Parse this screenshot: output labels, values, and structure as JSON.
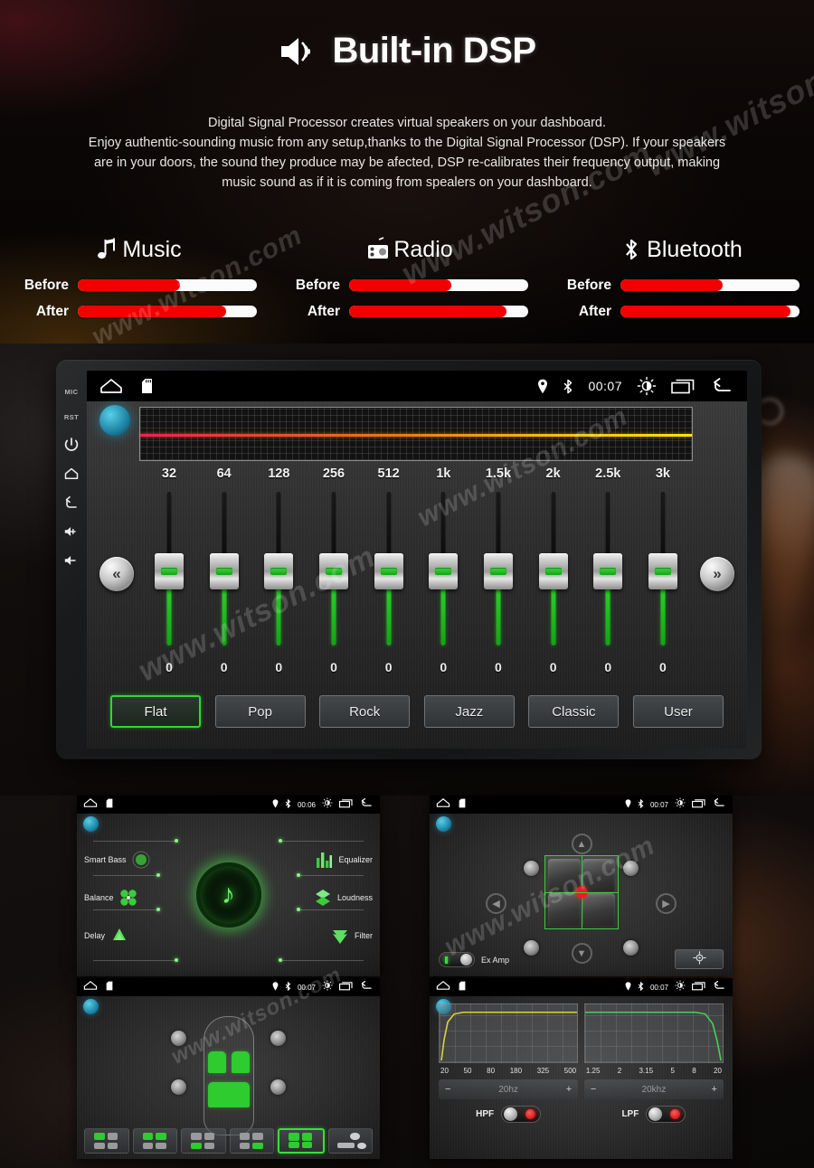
{
  "hero": {
    "icon": "speaker-wave-icon",
    "title": "Built-in DSP",
    "paragraph_lines": [
      "Digital Signal Processor creates virtual speakers on your dashboard.",
      "Enjoy authentic-sounding music from any setup,thanks to the Digital Signal Processor (DSP). If your speakers",
      "are in your doors, the sound they produce may be afected, DSP re-calibrates their frequency output, making",
      "music sound as if it is coming from spealers on your dashboard."
    ]
  },
  "comparison": {
    "before_label": "Before",
    "after_label": "After",
    "bar_empty_color": "#fbfbfb",
    "bar_fill_color": "#f20000",
    "columns": [
      {
        "icon": "music-note-icon",
        "label": "Music",
        "before_pct": 57,
        "after_pct": 83
      },
      {
        "icon": "radio-icon",
        "label": "Radio",
        "before_pct": 57,
        "after_pct": 88
      },
      {
        "icon": "bluetooth-icon",
        "label": "Bluetooth",
        "before_pct": 57,
        "after_pct": 95
      }
    ]
  },
  "device": {
    "side_buttons": [
      {
        "name": "mic-label",
        "label": "MIC",
        "type": "text"
      },
      {
        "name": "reset-label",
        "label": "RST",
        "type": "text"
      },
      {
        "name": "power-icon",
        "label": "",
        "type": "icon"
      },
      {
        "name": "home-icon",
        "label": "",
        "type": "icon"
      },
      {
        "name": "back-icon",
        "label": "",
        "type": "icon"
      },
      {
        "name": "volume-up-icon",
        "label": "",
        "type": "icon"
      },
      {
        "name": "volume-down-icon",
        "label": "",
        "type": "icon"
      }
    ],
    "statusbar": {
      "home_icon": "home-icon",
      "sdcard_icon": "sdcard-icon",
      "location_icon": "location-pin-icon",
      "bluetooth_icon": "bluetooth-icon",
      "clock": "00:07",
      "brightness_icon": "brightness-icon",
      "recents_icon": "recent-apps-icon",
      "back_icon": "back-arrow-icon"
    },
    "equalizer": {
      "prev_label": "«",
      "next_label": "»",
      "curve_gradient": [
        "#ff1569",
        "#f07a13",
        "#ffe400"
      ],
      "bands": [
        {
          "freq": "32",
          "value": "0"
        },
        {
          "freq": "64",
          "value": "0"
        },
        {
          "freq": "128",
          "value": "0"
        },
        {
          "freq": "256",
          "value": "0"
        },
        {
          "freq": "512",
          "value": "0"
        },
        {
          "freq": "1k",
          "value": "0"
        },
        {
          "freq": "1.5k",
          "value": "0"
        },
        {
          "freq": "2k",
          "value": "0"
        },
        {
          "freq": "2.5k",
          "value": "0"
        },
        {
          "freq": "3k",
          "value": "0"
        }
      ],
      "presets": [
        {
          "label": "Flat",
          "selected": true
        },
        {
          "label": "Pop",
          "selected": false
        },
        {
          "label": "Rock",
          "selected": false
        },
        {
          "label": "Jazz",
          "selected": false
        },
        {
          "label": "Classic",
          "selected": false
        },
        {
          "label": "User",
          "selected": false
        }
      ],
      "selected_preset": "Flat",
      "selected_color": "#2fd92f"
    }
  },
  "thumbnails": {
    "dsp_menu": {
      "clock": "00:06",
      "left_items": [
        {
          "label": "Smart Bass",
          "icon": "smart-bass-icon"
        },
        {
          "label": "Balance",
          "icon": "balance-icon"
        },
        {
          "label": "Delay",
          "icon": "delay-icon"
        }
      ],
      "right_items": [
        {
          "label": "Equalizer",
          "icon": "equalizer-icon"
        },
        {
          "label": "Loudness",
          "icon": "loudness-icon"
        },
        {
          "label": "Filter",
          "icon": "filter-icon"
        }
      ],
      "center_icon": "music-note-orb-icon"
    },
    "sound_field": {
      "clock": "00:07",
      "ex_amp_label": "Ex Amp",
      "ex_amp_on": true,
      "target_icon": "crosshair-icon",
      "up_icon": "chevron-up-icon",
      "down_icon": "chevron-down-icon",
      "left_icon": "chevron-left-icon",
      "right_icon": "chevron-right-icon"
    },
    "delay_seats": {
      "clock": "00:07",
      "presets": [
        {
          "name": "seat-preset-driver",
          "selected": false
        },
        {
          "name": "seat-preset-front-both",
          "selected": false
        },
        {
          "name": "seat-preset-rear-left",
          "selected": false
        },
        {
          "name": "seat-preset-rear-right",
          "selected": false
        },
        {
          "name": "seat-preset-all",
          "selected": true
        },
        {
          "name": "seat-preset-custom",
          "selected": false
        }
      ]
    },
    "filters": {
      "clock": "00:07",
      "hpf": {
        "name": "HPF",
        "ticks": [
          "20",
          "50",
          "80",
          "180",
          "325",
          "500"
        ],
        "value": "20hz",
        "minus": "−",
        "plus": "+",
        "enabled": true,
        "curve_color": "#d8d23c"
      },
      "lpf": {
        "name": "LPF",
        "ticks": [
          "1.25",
          "2",
          "3.15",
          "5",
          "8",
          "20"
        ],
        "value": "20khz",
        "minus": "−",
        "plus": "+",
        "enabled": true,
        "curve_color": "#48cf5a"
      }
    }
  },
  "watermarks": {
    "text": "www.witson.com"
  }
}
